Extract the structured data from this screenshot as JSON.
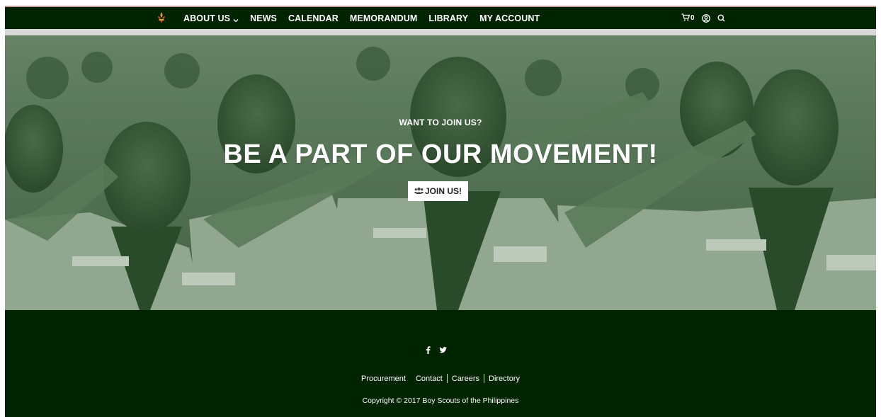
{
  "nav": {
    "logo_icon": "scout-fleur-de-lis-icon",
    "items": [
      {
        "label": "ABOUT US",
        "has_dropdown": true
      },
      {
        "label": "NEWS"
      },
      {
        "label": "CALENDAR"
      },
      {
        "label": "MEMORANDUM"
      },
      {
        "label": "LIBRARY"
      },
      {
        "label": "MY ACCOUNT"
      }
    ],
    "cart_count": "0",
    "icons": [
      "cart-icon",
      "user-icon",
      "search-icon"
    ]
  },
  "hero": {
    "kicker": "WANT TO JOIN US?",
    "title": "BE A PART OF OUR MOVEMENT!",
    "button_label": "JOIN US!",
    "button_icon": "users-icon",
    "overlay_color": "#1f4a1f"
  },
  "footer": {
    "social": [
      "facebook-icon",
      "twitter-icon"
    ],
    "links": [
      "Procurement",
      "Contact",
      "Careers",
      "Directory"
    ],
    "copyright": "Copyright © 2017 Boy Scouts of the Philippines"
  },
  "colors": {
    "nav_bg": "#002300",
    "footer_bg": "#002300",
    "text": "#ffffff"
  }
}
